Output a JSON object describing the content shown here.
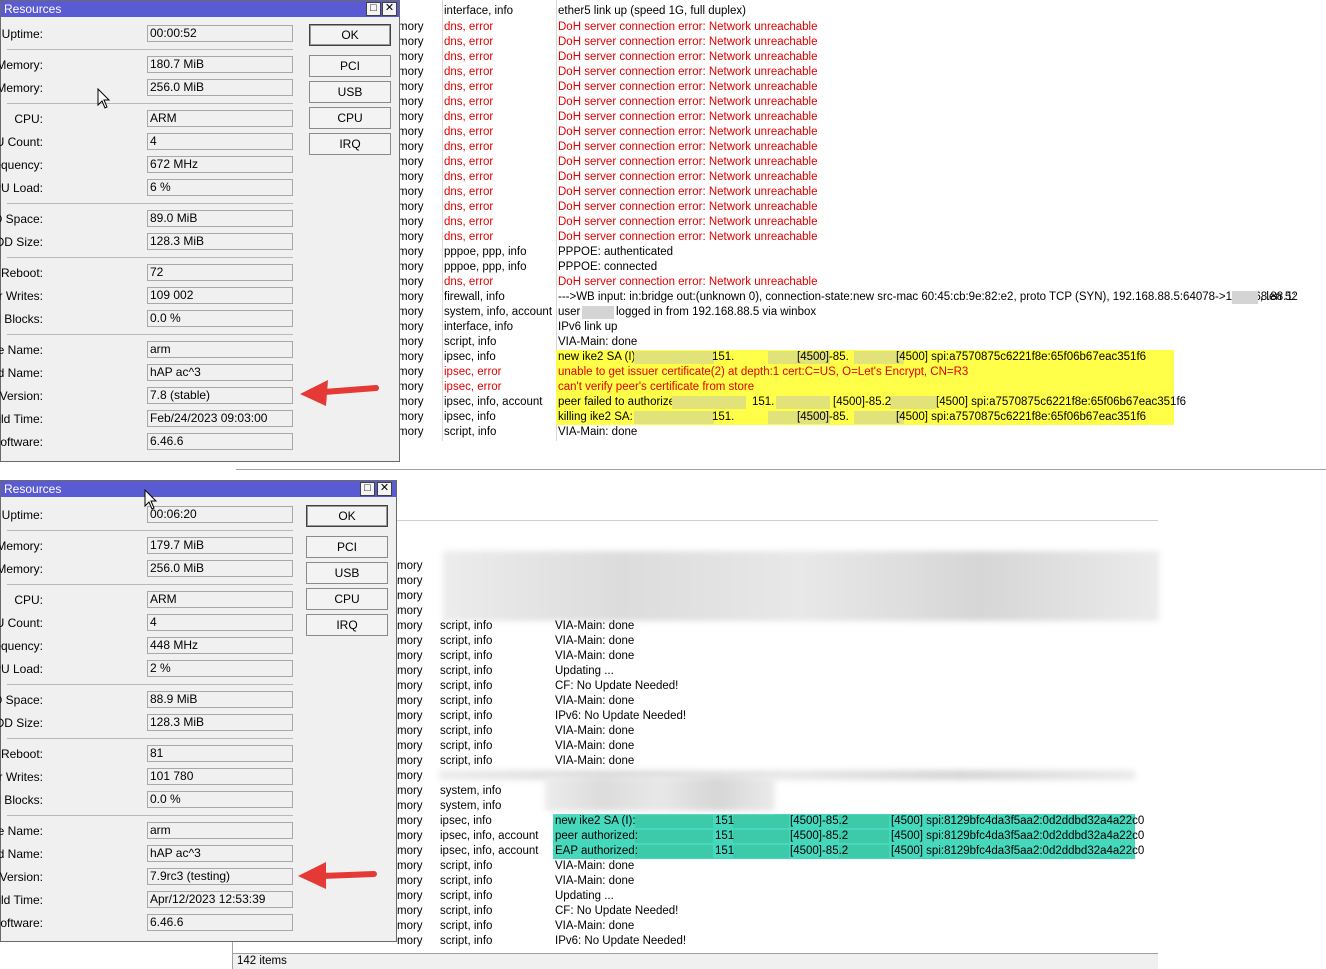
{
  "colors": {
    "title_bar": "#5a5ad2",
    "error_text": "#e00000",
    "highlight_yellow": "#ffff4a",
    "highlight_teal": "#46d8bc",
    "arrow_red": "#e53935"
  },
  "log1": {
    "first_row": {
      "topic": "interface, info",
      "message": "ether5 link up (speed 1G, full duplex)"
    },
    "rows": [
      {
        "src": "mory",
        "topic": "dns, error",
        "message": "DoH server connection error: Network unreachable",
        "err": true
      },
      {
        "src": "mory",
        "topic": "dns, error",
        "message": "DoH server connection error: Network unreachable",
        "err": true
      },
      {
        "src": "mory",
        "topic": "dns, error",
        "message": "DoH server connection error: Network unreachable",
        "err": true
      },
      {
        "src": "mory",
        "topic": "dns, error",
        "message": "DoH server connection error: Network unreachable",
        "err": true
      },
      {
        "src": "mory",
        "topic": "dns, error",
        "message": "DoH server connection error: Network unreachable",
        "err": true
      },
      {
        "src": "mory",
        "topic": "dns, error",
        "message": "DoH server connection error: Network unreachable",
        "err": true
      },
      {
        "src": "mory",
        "topic": "dns, error",
        "message": "DoH server connection error: Network unreachable",
        "err": true
      },
      {
        "src": "mory",
        "topic": "dns, error",
        "message": "DoH server connection error: Network unreachable",
        "err": true
      },
      {
        "src": "mory",
        "topic": "dns, error",
        "message": "DoH server connection error: Network unreachable",
        "err": true
      },
      {
        "src": "mory",
        "topic": "dns, error",
        "message": "DoH server connection error: Network unreachable",
        "err": true
      },
      {
        "src": "mory",
        "topic": "dns, error",
        "message": "DoH server connection error: Network unreachable",
        "err": true
      },
      {
        "src": "mory",
        "topic": "dns, error",
        "message": "DoH server connection error: Network unreachable",
        "err": true
      },
      {
        "src": "mory",
        "topic": "dns, error",
        "message": "DoH server connection error: Network unreachable",
        "err": true
      },
      {
        "src": "mory",
        "topic": "dns, error",
        "message": "DoH server connection error: Network unreachable",
        "err": true
      },
      {
        "src": "mory",
        "topic": "dns, error",
        "message": "DoH server connection error: Network unreachable",
        "err": true
      },
      {
        "src": "mory",
        "topic": "pppoe, ppp, info",
        "message": "PPPOE: authenticated",
        "err": false
      },
      {
        "src": "mory",
        "topic": "pppoe, ppp, info",
        "message": "PPPOE: connected",
        "err": false
      },
      {
        "src": "mory",
        "topic": "dns, error",
        "message": "DoH server connection error: Network unreachable",
        "err": true
      },
      {
        "src": "mory",
        "topic": "firewall, info",
        "message": "--->WB input: in:bridge out:(unknown 0), connection-state:new src-mac 60:45:cb:9e:82:e2, proto TCP (SYN), 192.168.88.5:64078->192.168.88.1:",
        "suffix": ", len 52",
        "err": false
      },
      {
        "src": "mory",
        "topic": "system, info, account",
        "message": "user",
        "suffix": "logged in from 192.168.88.5 via winbox",
        "err": false
      },
      {
        "src": "mory",
        "topic": "interface, info",
        "message": "IPv6 link up",
        "err": false
      },
      {
        "src": "mory",
        "topic": "script, info",
        "message": "VIA-Main: done",
        "err": false
      },
      {
        "src": "mory",
        "topic": "ipsec, info",
        "message": "new ike2 SA (I):",
        "parts": [
          "151.",
          "[4500]-85.",
          "[4500] spi:a7570875c6221f8e:65f06b67eac351f6"
        ],
        "err": false,
        "hl": "yellow"
      },
      {
        "src": "mory",
        "topic": "ipsec, error",
        "message": "unable to get issuer certificate(2) at depth:1 cert:C=US, O=Let's Encrypt, CN=R3",
        "err": true,
        "hl": "yellow"
      },
      {
        "src": "mory",
        "topic": "ipsec, error",
        "message": "can't verify peer's certificate from store",
        "err": true,
        "hl": "yellow"
      },
      {
        "src": "mory",
        "topic": "ipsec, info, account",
        "message": "peer failed to authorize:",
        "parts": [
          "151.",
          "[4500]-85.2",
          "[4500] spi:a7570875c6221f8e:65f06b67eac351f6"
        ],
        "err": false,
        "hl": "yellow"
      },
      {
        "src": "mory",
        "topic": "ipsec, info",
        "message": "killing ike2 SA:",
        "parts": [
          "151.",
          "[4500]-85.",
          "[4500] spi:a7570875c6221f8e:65f06b67eac351f6"
        ],
        "err": false,
        "hl": "yellow"
      },
      {
        "src": "mory",
        "topic": "script, info",
        "message": "VIA-Main: done",
        "err": false
      }
    ]
  },
  "log2": {
    "blur_src_rows": [
      "mory",
      "mory",
      "mory",
      "mory"
    ],
    "rows": [
      {
        "src": "mory",
        "topic": "script, info",
        "message": "VIA-Main: done"
      },
      {
        "src": "mory",
        "topic": "script, info",
        "message": "VIA-Main: done"
      },
      {
        "src": "mory",
        "topic": "script, info",
        "message": "VIA-Main: done"
      },
      {
        "src": "mory",
        "topic": "script, info",
        "message": "Updating  ..."
      },
      {
        "src": "mory",
        "topic": "script, info",
        "message": "CF: No Update Needed!"
      },
      {
        "src": "mory",
        "topic": "script, info",
        "message": "VIA-Main: done"
      },
      {
        "src": "mory",
        "topic": "script, info",
        "message": "IPv6: No Update Needed!"
      },
      {
        "src": "mory",
        "topic": "script, info",
        "message": "VIA-Main: done"
      },
      {
        "src": "mory",
        "topic": "script, info",
        "message": "VIA-Main: done"
      },
      {
        "src": "mory",
        "topic": "script, info",
        "message": "VIA-Main: done"
      },
      {
        "src": "mory",
        "topic": "",
        "message": ""
      },
      {
        "src": "mory",
        "topic": "system, info",
        "message": ""
      },
      {
        "src": "mory",
        "topic": "system, info",
        "message": ""
      },
      {
        "src": "mory",
        "topic": "ipsec, info",
        "message": "new ike2 SA (I):",
        "parts": [
          "151",
          "[4500]-85.2",
          "[4500] spi:8129bfc4da3f5aa2:0d2ddbd32a4a22c0"
        ],
        "hl": "teal"
      },
      {
        "src": "mory",
        "topic": "ipsec, info, account",
        "message": "peer authorized:",
        "parts": [
          "151",
          "[4500]-85.2",
          "[4500] spi:8129bfc4da3f5aa2:0d2ddbd32a4a22c0"
        ],
        "hl": "teal"
      },
      {
        "src": "mory",
        "topic": "ipsec, info, account",
        "message": "EAP authorized:",
        "parts": [
          "151",
          "[4500]-85.2",
          "[4500] spi:8129bfc4da3f5aa2:0d2ddbd32a4a22c0"
        ],
        "hl": "teal"
      },
      {
        "src": "mory",
        "topic": "script, info",
        "message": "VIA-Main: done"
      },
      {
        "src": "mory",
        "topic": "script, info",
        "message": "VIA-Main: done"
      },
      {
        "src": "mory",
        "topic": "script, info",
        "message": "Updating  ..."
      },
      {
        "src": "mory",
        "topic": "script, info",
        "message": "CF: No Update Needed!"
      },
      {
        "src": "mory",
        "topic": "script, info",
        "message": "VIA-Main: done"
      },
      {
        "src": "mory",
        "topic": "script, info",
        "message": "IPv6: No Update Needed!"
      }
    ],
    "items_count": "142 items"
  },
  "win1": {
    "title": "Resources",
    "buttons": {
      "ok": "OK",
      "pci": "PCI",
      "usb": "USB",
      "cpu": "CPU",
      "irq": "IRQ"
    },
    "fields": [
      {
        "label": "Uptime:",
        "value": "00:00:52"
      },
      {
        "label": "Free Memory:",
        "value": "180.7 MiB"
      },
      {
        "label": "Total Memory:",
        "value": "256.0 MiB"
      },
      {
        "label": "CPU:",
        "value": "ARM"
      },
      {
        "label": "CPU Count:",
        "value": "4"
      },
      {
        "label": "CPU Frequency:",
        "value": "672 MHz"
      },
      {
        "label": "CPU Load:",
        "value": "6 %"
      },
      {
        "label": "Free HDD Space:",
        "value": "89.0 MiB"
      },
      {
        "label": "Total HDD Size:",
        "value": "128.3 MiB"
      },
      {
        "label": "Sector Writes Since Reboot:",
        "value": "72"
      },
      {
        "label": "Total Sector Writes:",
        "value": "109 002"
      },
      {
        "label": "Bad Blocks:",
        "value": "0.0 %"
      },
      {
        "label": "Architecture Name:",
        "value": "arm"
      },
      {
        "label": "Board Name:",
        "value": "hAP ac^3"
      },
      {
        "label": "Version:",
        "value": "7.8 (stable)"
      },
      {
        "label": "Build Time:",
        "value": "Feb/24/2023 09:03:00"
      },
      {
        "label": "Factory Software:",
        "value": "6.46.6"
      }
    ]
  },
  "win2": {
    "title": "Resources",
    "buttons": {
      "ok": "OK",
      "pci": "PCI",
      "usb": "USB",
      "cpu": "CPU",
      "irq": "IRQ"
    },
    "fields": [
      {
        "label": "Uptime:",
        "value": "00:06:20"
      },
      {
        "label": "Free Memory:",
        "value": "179.7 MiB"
      },
      {
        "label": "Total Memory:",
        "value": "256.0 MiB"
      },
      {
        "label": "CPU:",
        "value": "ARM"
      },
      {
        "label": "CPU Count:",
        "value": "4"
      },
      {
        "label": "CPU Frequency:",
        "value": "448 MHz"
      },
      {
        "label": "CPU Load:",
        "value": "2 %"
      },
      {
        "label": "Free HDD Space:",
        "value": "88.9 MiB"
      },
      {
        "label": "Total HDD Size:",
        "value": "128.3 MiB"
      },
      {
        "label": "Sector Writes Since Reboot:",
        "value": "81"
      },
      {
        "label": "Total Sector Writes:",
        "value": "101 780"
      },
      {
        "label": "Bad Blocks:",
        "value": "0.0 %"
      },
      {
        "label": "Architecture Name:",
        "value": "arm"
      },
      {
        "label": "Board Name:",
        "value": "hAP ac^3"
      },
      {
        "label": "Version:",
        "value": "7.9rc3 (testing)"
      },
      {
        "label": "Build Time:",
        "value": "Apr/12/2023 12:53:39"
      },
      {
        "label": "Factory Software:",
        "value": "6.46.6"
      }
    ]
  }
}
